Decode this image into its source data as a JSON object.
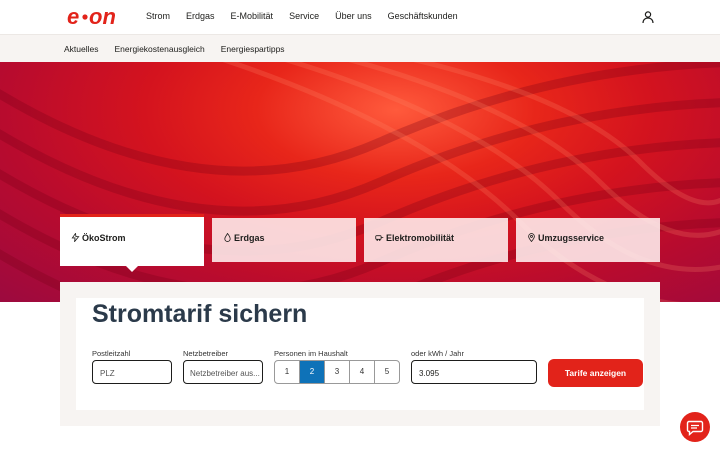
{
  "brand": {
    "logo_text": "e·on",
    "accent": "#e2231a"
  },
  "topnav": {
    "items": [
      "Strom",
      "Erdgas",
      "E-Mobilität",
      "Service",
      "Über uns",
      "Geschäftskunden"
    ],
    "user_icon": "user-icon"
  },
  "subnav": {
    "items": [
      "Aktuelles",
      "Energiekostenausgleich",
      "Energiespartipps"
    ]
  },
  "tabs": [
    {
      "label": "ÖkoStrom",
      "icon": "leaf-bolt-icon",
      "active": true
    },
    {
      "label": "Erdgas",
      "icon": "flame-icon",
      "active": false
    },
    {
      "label": "Elektromobilität",
      "icon": "car-plug-icon",
      "active": false
    },
    {
      "label": "Umzugsservice",
      "icon": "location-pin-icon",
      "active": false
    }
  ],
  "form": {
    "title": "Stromtarif sichern",
    "postcode": {
      "label": "Postleitzahl",
      "placeholder": "PLZ"
    },
    "operator": {
      "label": "Netzbetreiber",
      "placeholder": "Netzbetreiber aus..."
    },
    "household": {
      "label": "Personen im Haushalt",
      "options": [
        "1",
        "2",
        "3",
        "4",
        "5"
      ],
      "selected": "2"
    },
    "consumption": {
      "label": "oder kWh / Jahr",
      "value": "3.095"
    },
    "submit_label": "Tarife anzeigen"
  },
  "chat": {
    "icon": "chat-icon"
  }
}
